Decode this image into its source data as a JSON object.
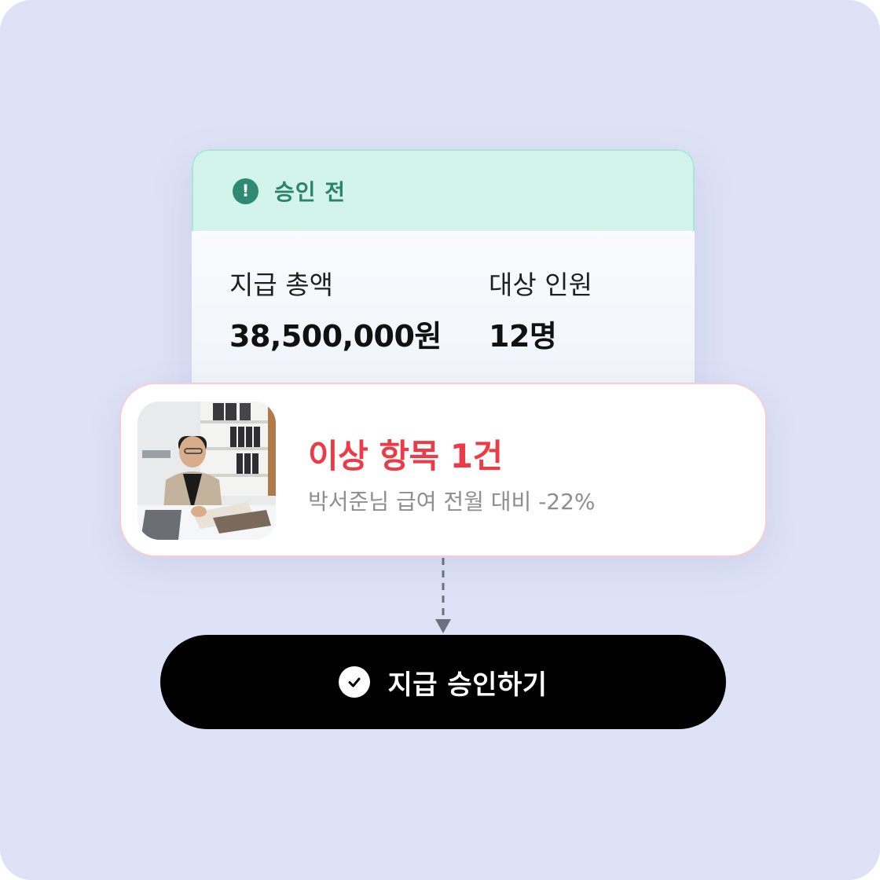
{
  "summary": {
    "status_label": "승인 전",
    "status_icon": "exclamation-circle-icon",
    "total_label": "지급 총액",
    "total_value": "38,500,000원",
    "people_label": "대상 인원",
    "people_value": "12명"
  },
  "alert": {
    "title": "이상 항목 1건",
    "detail": "박서준님 급여 전월 대비 -22%",
    "photo_icon": "employee-photo"
  },
  "action": {
    "approve_label": "지급 승인하기",
    "approve_icon": "check-circle-icon"
  },
  "colors": {
    "background": "#dde2f6",
    "status_bg": "#d3f4ea",
    "status_text": "#2b8468",
    "alert_red": "#ec3b46",
    "button_bg": "#000000"
  }
}
